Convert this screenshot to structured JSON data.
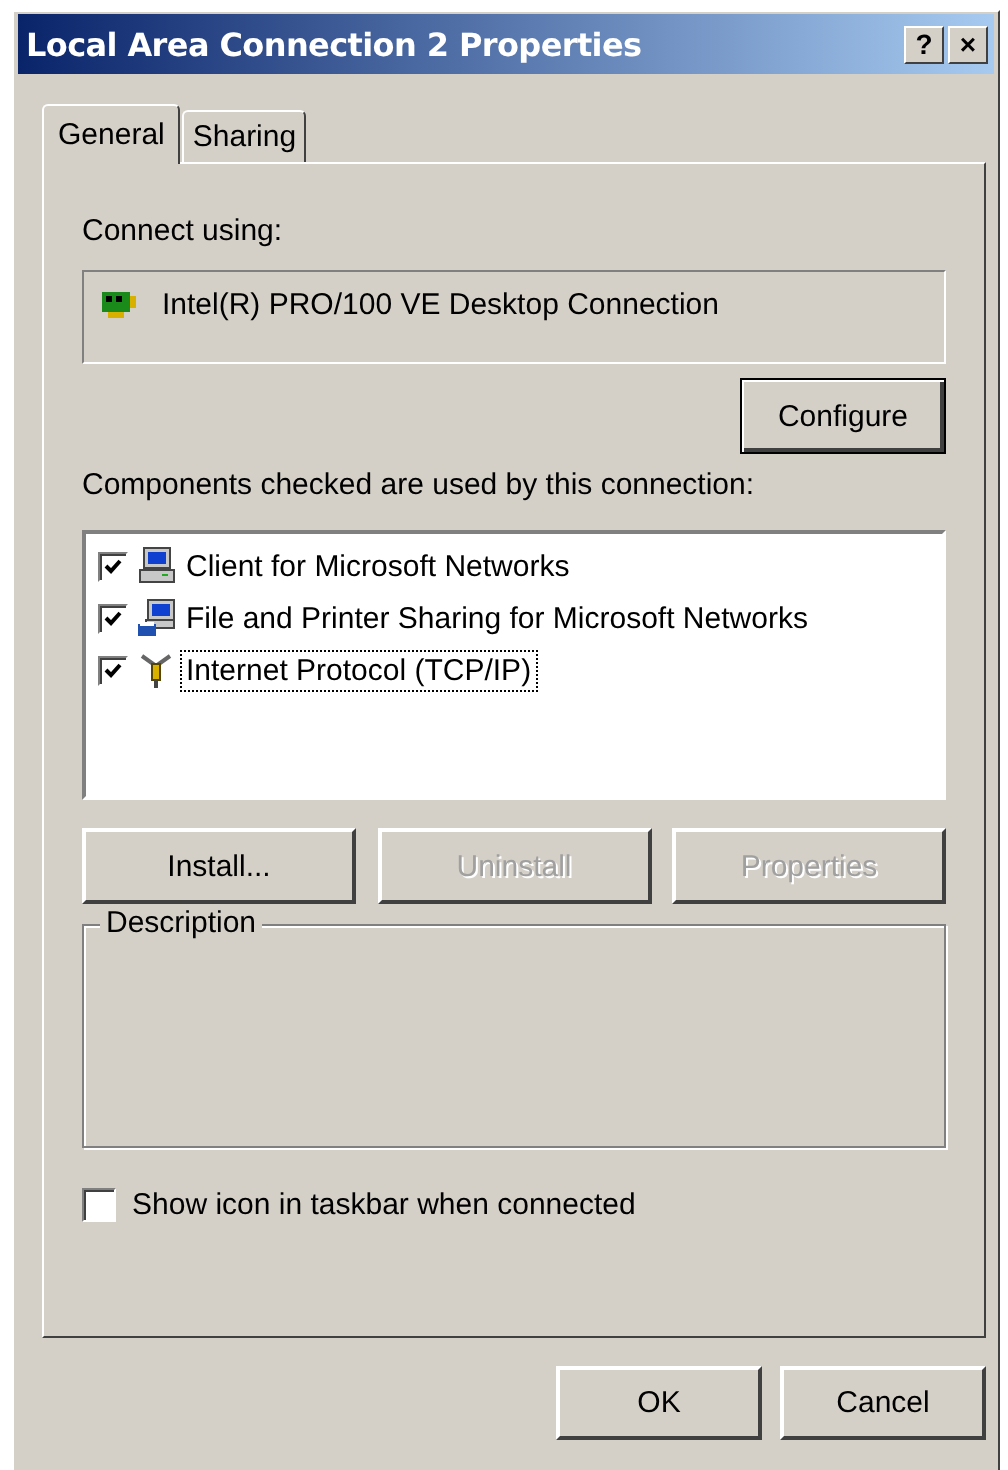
{
  "window": {
    "title": "Local Area Connection 2 Properties",
    "help_button": "?",
    "close_button": "×"
  },
  "tabs": [
    {
      "label": "General",
      "selected": true
    },
    {
      "label": "Sharing",
      "selected": false
    }
  ],
  "connect_using": {
    "label": "Connect using:",
    "adapter": "Intel(R) PRO/100 VE Desktop Connection",
    "configure_button": "Configure"
  },
  "components": {
    "label": "Components checked are used by this connection:",
    "items": [
      {
        "label": "Client for Microsoft Networks",
        "checked": true,
        "focused": false,
        "kind": "client"
      },
      {
        "label": "File and Printer Sharing for Microsoft Networks",
        "checked": true,
        "focused": false,
        "kind": "service"
      },
      {
        "label": "Internet Protocol (TCP/IP)",
        "checked": true,
        "focused": true,
        "kind": "protocol"
      }
    ]
  },
  "component_buttons": [
    {
      "label": "Install...",
      "disabled": false
    },
    {
      "label": "Uninstall",
      "disabled": true
    },
    {
      "label": "Properties",
      "disabled": true
    }
  ],
  "description": {
    "title": "Description"
  },
  "show_icon": {
    "label": "Show icon in taskbar when connected",
    "checked": false
  },
  "dialog_buttons": [
    "OK",
    "Cancel"
  ]
}
